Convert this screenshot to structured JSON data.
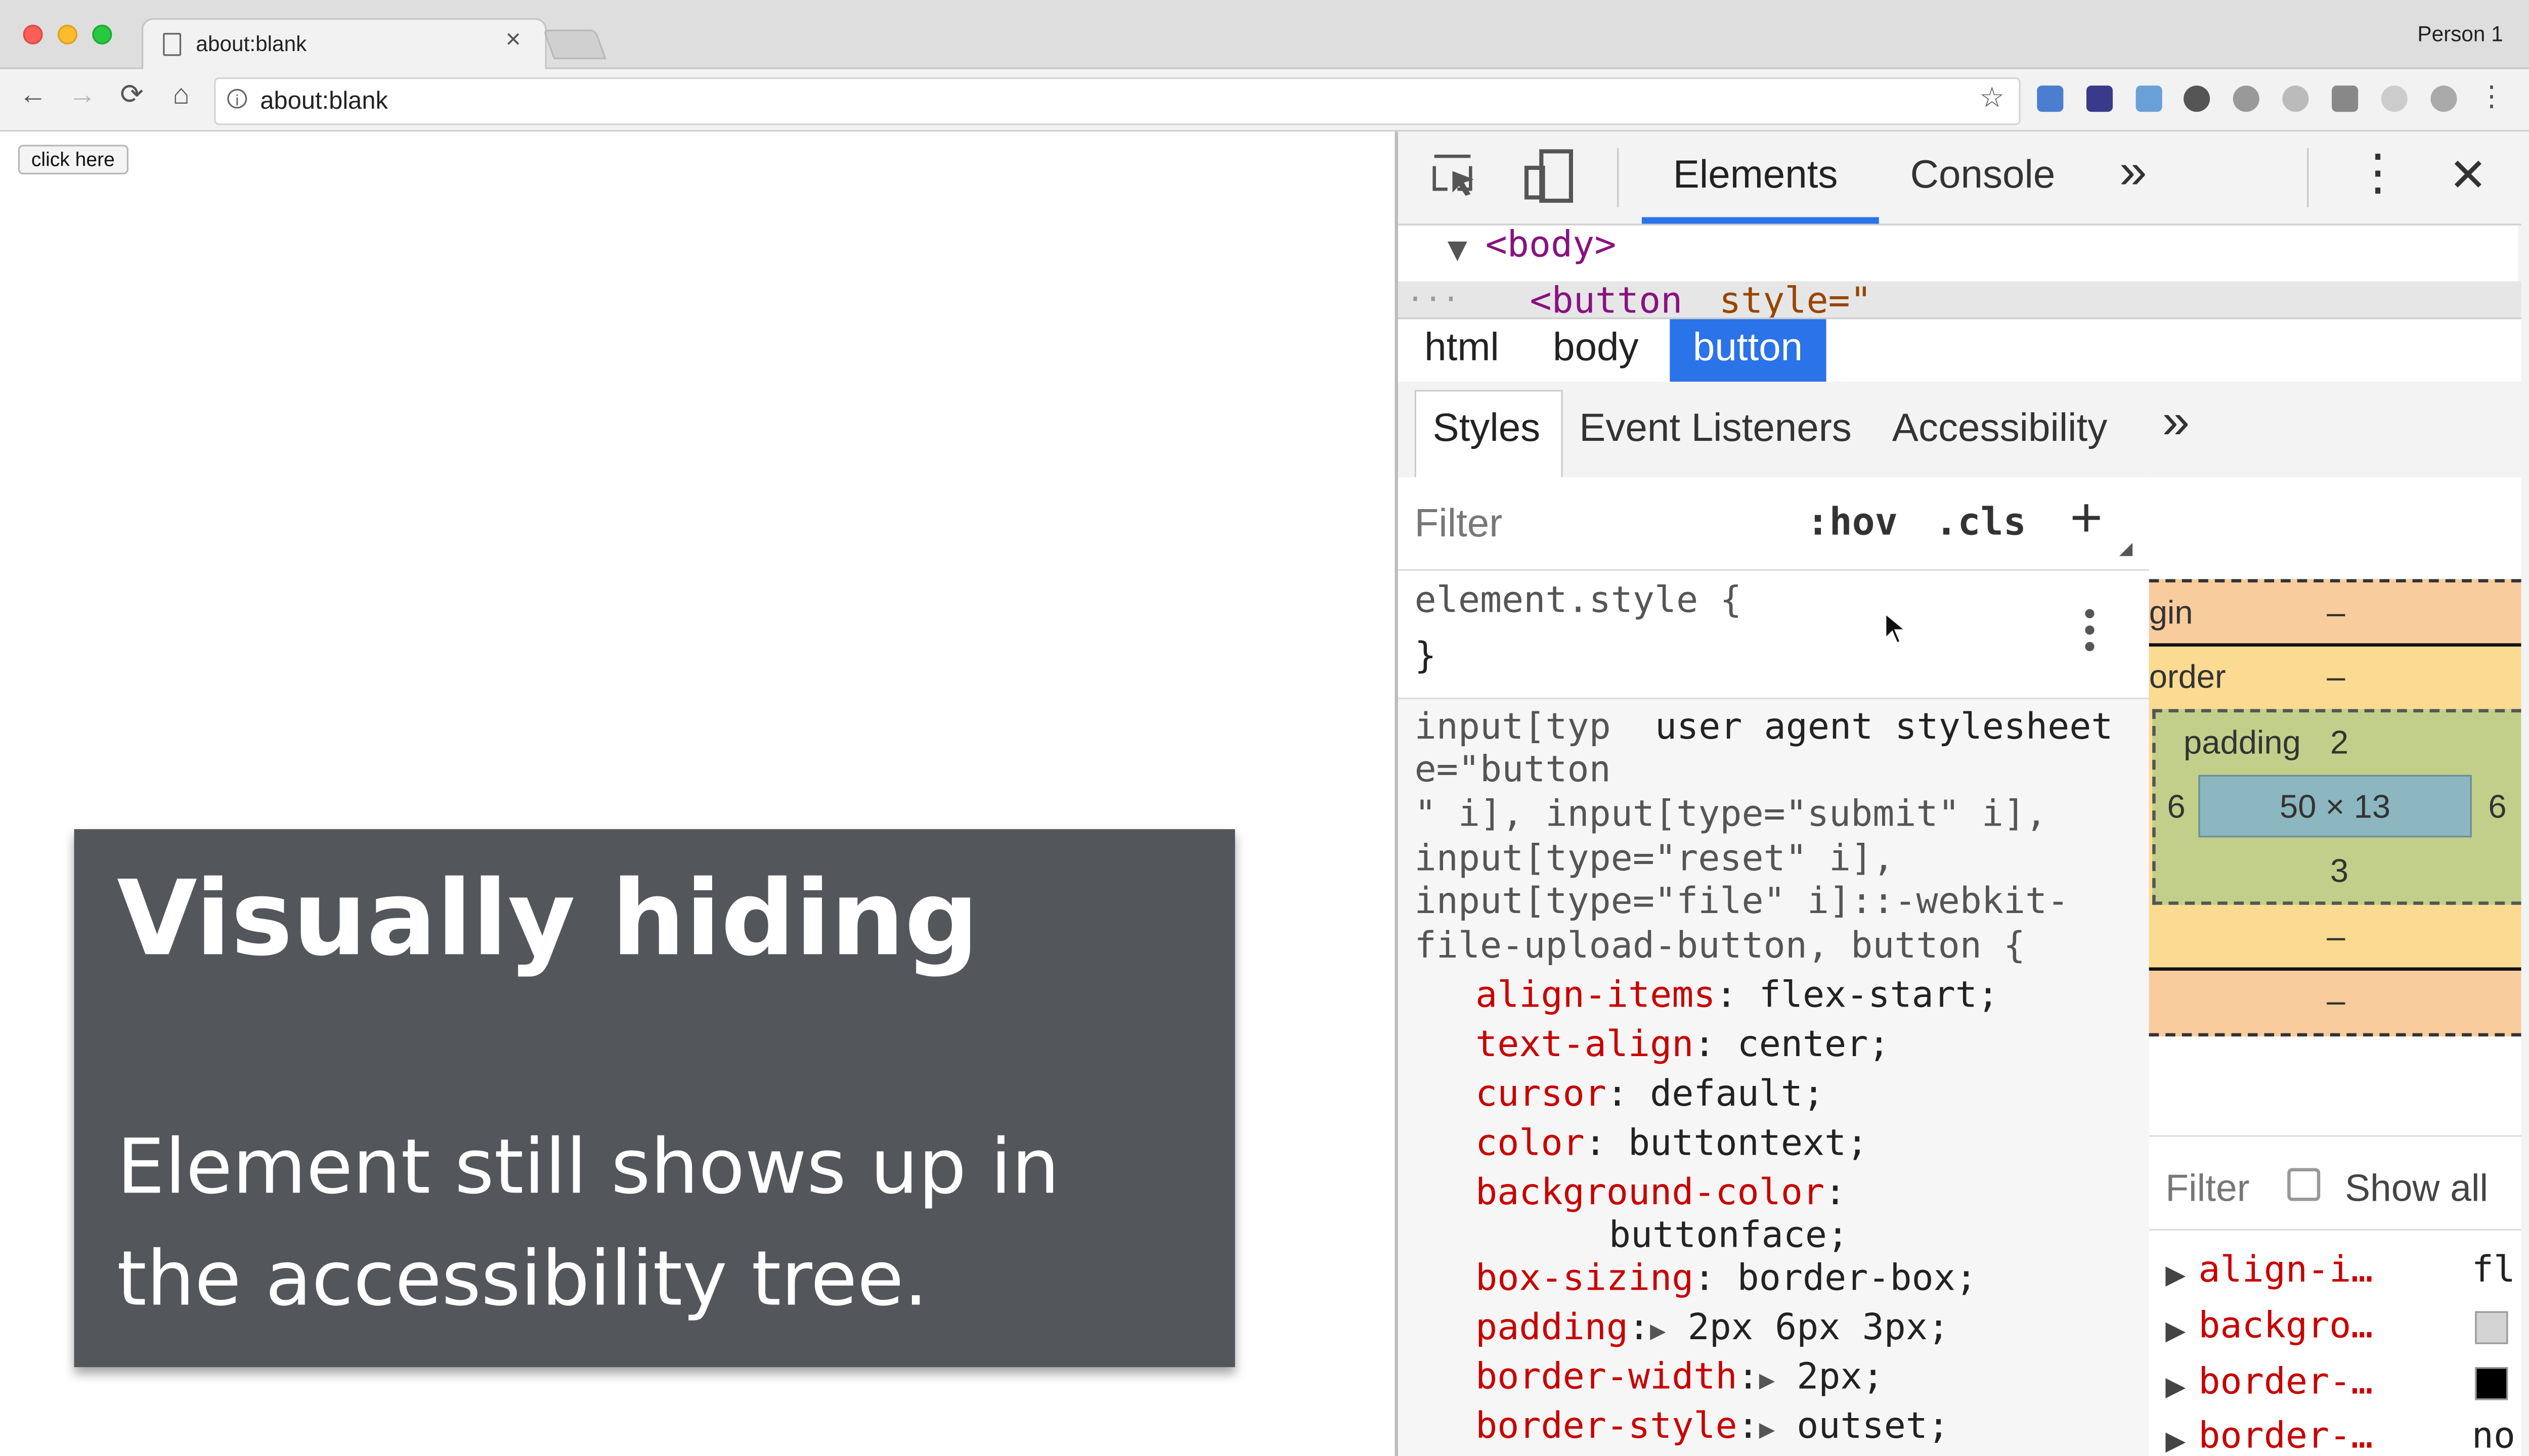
{
  "browser": {
    "tab_title": "about:blank",
    "tab_close": "×",
    "profile": "Person 1",
    "url": "about:blank",
    "nav": {
      "back": "←",
      "forward": "→",
      "reload": "⟳",
      "home": "⌂",
      "star": "☆",
      "menu": "⋮"
    }
  },
  "page": {
    "button_label": "click here"
  },
  "slide": {
    "heading": "Visually hiding",
    "body_line1": "Element still shows up in",
    "body_line2": "the accessibility tree."
  },
  "devtools": {
    "tabs": [
      "Elements",
      "Console"
    ],
    "more": "»",
    "kebab": "⋮",
    "close": "✕",
    "dom": {
      "body_tag": "<body>",
      "ellipsis": "...",
      "button_open": "<button",
      "button_attr": "style=\""
    },
    "breadcrumbs": [
      "html",
      "body",
      "button"
    ],
    "subtabs": [
      "Styles",
      "Event Listeners",
      "Accessibility"
    ],
    "styles": {
      "filter_placeholder": "Filter",
      "hov": ":hov",
      "cls": ".cls",
      "add": "+",
      "element_style_open": "element.style {",
      "element_style_close": "}",
      "selector_lines": [
        "input[typ",
        "e=\"button",
        "\" i], input[type=\"submit\" i],",
        "input[type=\"reset\" i],",
        "input[type=\"file\" i]::-webkit-",
        "file-upload-button, button {"
      ],
      "source": "user agent stylesheet",
      "properties": [
        {
          "name": "align-items",
          "value": "flex-start;"
        },
        {
          "name": "text-align",
          "value": "center;"
        },
        {
          "name": "cursor",
          "value": "default;"
        },
        {
          "name": "color",
          "value": "buttontext;"
        },
        {
          "name": "background-color",
          "value": ""
        },
        {
          "name": "",
          "value": "buttonface;"
        },
        {
          "name": "box-sizing",
          "value": "border-box;"
        },
        {
          "name": "padding",
          "value": "2px 6px 3px;"
        },
        {
          "name": "border-width",
          "value": "2px;"
        },
        {
          "name": "border-style",
          "value": "outset;"
        }
      ]
    },
    "box_model": {
      "margin_label": "gin",
      "border_label": "order",
      "padding_label": "padding",
      "padding_top": "2",
      "padding_left": "6",
      "padding_right": "6",
      "padding_bottom": "3",
      "content_size": "50 × 13",
      "dash": "–"
    },
    "computed": {
      "filter_placeholder": "Filter",
      "show_all": "Show all",
      "rows": [
        {
          "name": "align-i…",
          "value": "fl"
        },
        {
          "name": "backgro…",
          "value": "",
          "swatch": "#d4d4d4"
        },
        {
          "name": "border-…",
          "value": "",
          "swatch": "#000000"
        },
        {
          "name": "border-…",
          "value": "no"
        }
      ]
    }
  }
}
